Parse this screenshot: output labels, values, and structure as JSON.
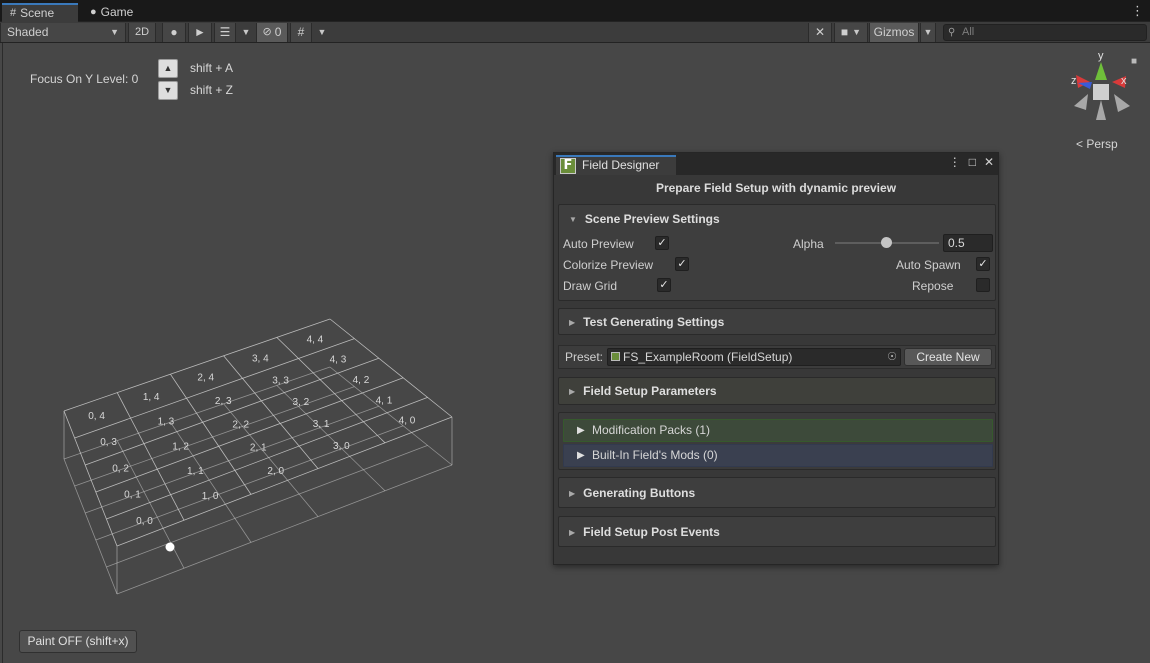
{
  "tabs": [
    {
      "label": "Scene",
      "icon": "grid-icon",
      "active": true
    },
    {
      "label": "Game",
      "icon": "gamepad-icon",
      "active": false
    }
  ],
  "toolbar": {
    "shading_mode": "Shaded",
    "mode_2d": "2D",
    "hidden_count": "0",
    "gizmos": "Gizmos",
    "search_placeholder": "All"
  },
  "scene": {
    "focus_label": "Focus On Y Level: 0",
    "shortcut_up": "shift + A",
    "shortcut_down": "shift + Z",
    "persp_label": "Persp",
    "paint_button": "Paint OFF (shift+x)",
    "gizmo_axes": {
      "y": "y",
      "x": "x",
      "z": "z"
    },
    "grid_cells": [
      "0, 0",
      "1, 0",
      "0, 1",
      "2, 0",
      "1, 1",
      "0, 2",
      "3, 0",
      "2, 1",
      "1, 2",
      "0, 3",
      "4, 0",
      "3, 1",
      "2, 2",
      "1, 3",
      "0, 4",
      "4, 1",
      "3, 2",
      "2, 3",
      "1, 4",
      "4, 2",
      "3, 3",
      "2, 4",
      "4, 3",
      "3, 4",
      "4, 4"
    ]
  },
  "field_designer": {
    "tab_title": "Field Designer",
    "logo_letter": "F",
    "header": "Prepare Field Setup with dynamic preview",
    "scene_preview": {
      "title": "Scene Preview Settings",
      "auto_preview": "Auto Preview",
      "colorize_preview": "Colorize Preview",
      "draw_grid": "Draw Grid",
      "alpha": "Alpha",
      "alpha_value": "0.5",
      "alpha_level": 0.5,
      "auto_spawn": "Auto Spawn",
      "repose": "Repose"
    },
    "test_generating": "Test Generating Settings",
    "preset": {
      "label": "Preset:",
      "value": "FS_ExampleRoom (FieldSetup)",
      "create_new": "Create New"
    },
    "field_setup_parameters": "Field Setup Parameters",
    "modification_packs": "Modification Packs (1)",
    "builtin_mods": "Built-In Field's Mods (0)",
    "generating_buttons": "Generating Buttons",
    "post_events": "Field Setup Post Events"
  },
  "colors": {
    "accent_tab": "#3a79bb",
    "mod_packs_bg": "#3d4a3a",
    "builtin_bg": "#3a4050"
  }
}
